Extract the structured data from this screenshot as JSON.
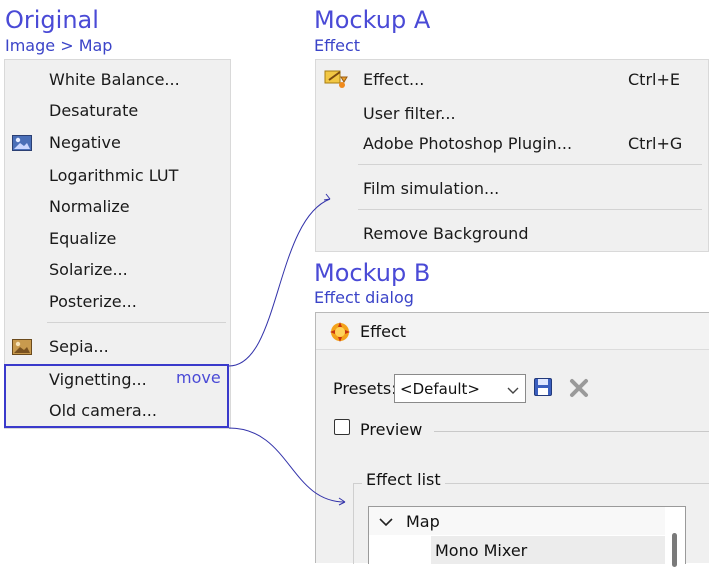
{
  "headings": {
    "original_title": "Original",
    "original_path": "Image > Map",
    "mockup_a_title": "Mockup A",
    "mockup_a_path": "Effect",
    "mockup_b_title": "Mockup B",
    "mockup_b_path": "Effect  dialog"
  },
  "original_menu": {
    "items": [
      {
        "label": "White Balance..."
      },
      {
        "label": "Desaturate"
      },
      {
        "label": "Negative",
        "icon": "negative-image-icon"
      },
      {
        "label": "Logarithmic LUT"
      },
      {
        "label": "Normalize"
      },
      {
        "label": "Equalize"
      },
      {
        "label": "Solarize..."
      },
      {
        "label": "Posterize..."
      },
      {
        "label": "Sepia...",
        "icon": "sepia-image-icon"
      },
      {
        "label": "Vignetting..."
      },
      {
        "label": "Old camera..."
      }
    ],
    "move_note": "move"
  },
  "mockup_a_menu": {
    "items": [
      {
        "label": "Effect...",
        "shortcut": "Ctrl+E",
        "icon": "effect-wand-icon"
      },
      {
        "label": "User filter...",
        "shortcut": ""
      },
      {
        "label": "Adobe Photoshop Plugin...",
        "shortcut": "Ctrl+G"
      },
      {
        "label": "Film simulation...",
        "shortcut": ""
      },
      {
        "label": "Remove Background",
        "shortcut": ""
      }
    ]
  },
  "mockup_b_dialog": {
    "title": "Effect",
    "presets_label": "Presets:",
    "presets_value": "<Default>",
    "preview_label": "Preview",
    "effect_list_label": "Effect list",
    "tree": {
      "category": "Map",
      "child": "Mono Mixer"
    }
  },
  "colors": {
    "accent": "#3a3acb",
    "menu_bg": "#f0f0f0"
  }
}
